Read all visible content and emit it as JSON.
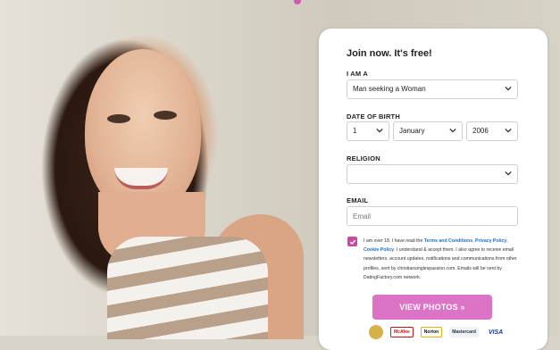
{
  "form": {
    "heading": "Join now. It's free!",
    "i_am_label": "I AM A",
    "i_am_value": "Man seeking a Woman",
    "dob_label": "DATE OF BIRTH",
    "dob_day": "1",
    "dob_month": "January",
    "dob_year": "2006",
    "religion_label": "RELIGION",
    "religion_value": "",
    "email_label": "EMAIL",
    "email_placeholder": "Email",
    "terms": {
      "prefix": "I am over 18. I have read the ",
      "link1": "Terms and Conditions",
      "sep1": ", ",
      "link2": "Privacy Policy",
      "sep2": ", ",
      "link3": "Cookie Policy",
      "suffix": ". I understand & accept them. I also agree to receive email newsletters, account updates, notifications and communications from other profiles, sent by christiansinglespassion.com. Emails will be sent by DatingFactory.com network."
    },
    "cta_label": "VIEW PHOTOS »"
  },
  "trust_logos": [
    "McAfee",
    "Norton",
    "Mastercard",
    "VISA"
  ],
  "colors": {
    "accent": "#dd73c4",
    "checkbox": "#c84aa4",
    "link": "#1f6fd1"
  }
}
